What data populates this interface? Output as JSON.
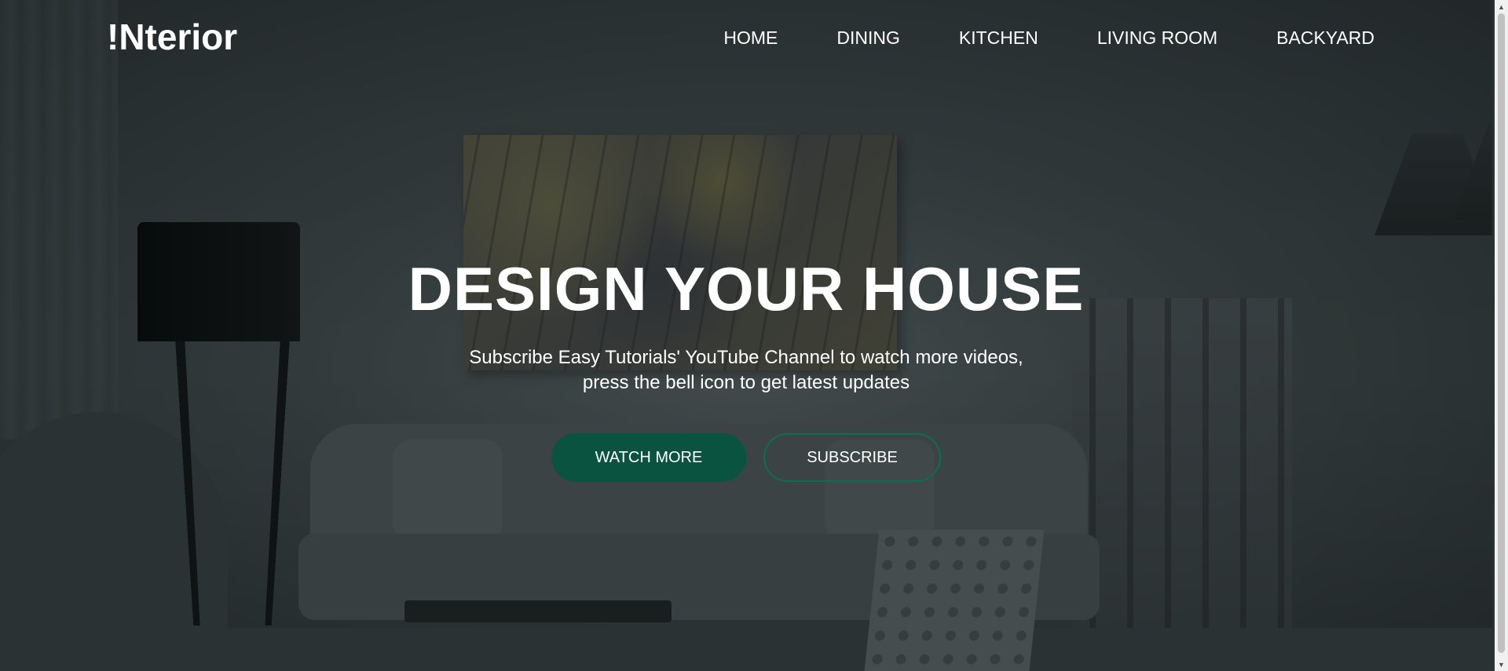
{
  "brand": {
    "logo": "!Nterior"
  },
  "nav": {
    "items": [
      {
        "label": "HOME"
      },
      {
        "label": "DINING"
      },
      {
        "label": "KITCHEN"
      },
      {
        "label": "LIVING ROOM"
      },
      {
        "label": "BACKYARD"
      }
    ]
  },
  "hero": {
    "title": "DESIGN YOUR HOUSE",
    "subtitle_line1": "Subscribe Easy Tutorials' YouTube Channel to watch more videos,",
    "subtitle_line2": "press the bell icon to get latest updates",
    "primary_button": "WATCH MORE",
    "secondary_button": "SUBSCRIBE"
  },
  "colors": {
    "accent": "#0b5341",
    "accent_border": "#0d6d52",
    "text": "#ffffff"
  },
  "icons": {
    "scroll_up": "triangle-up-icon",
    "scroll_down": "triangle-down-icon"
  }
}
